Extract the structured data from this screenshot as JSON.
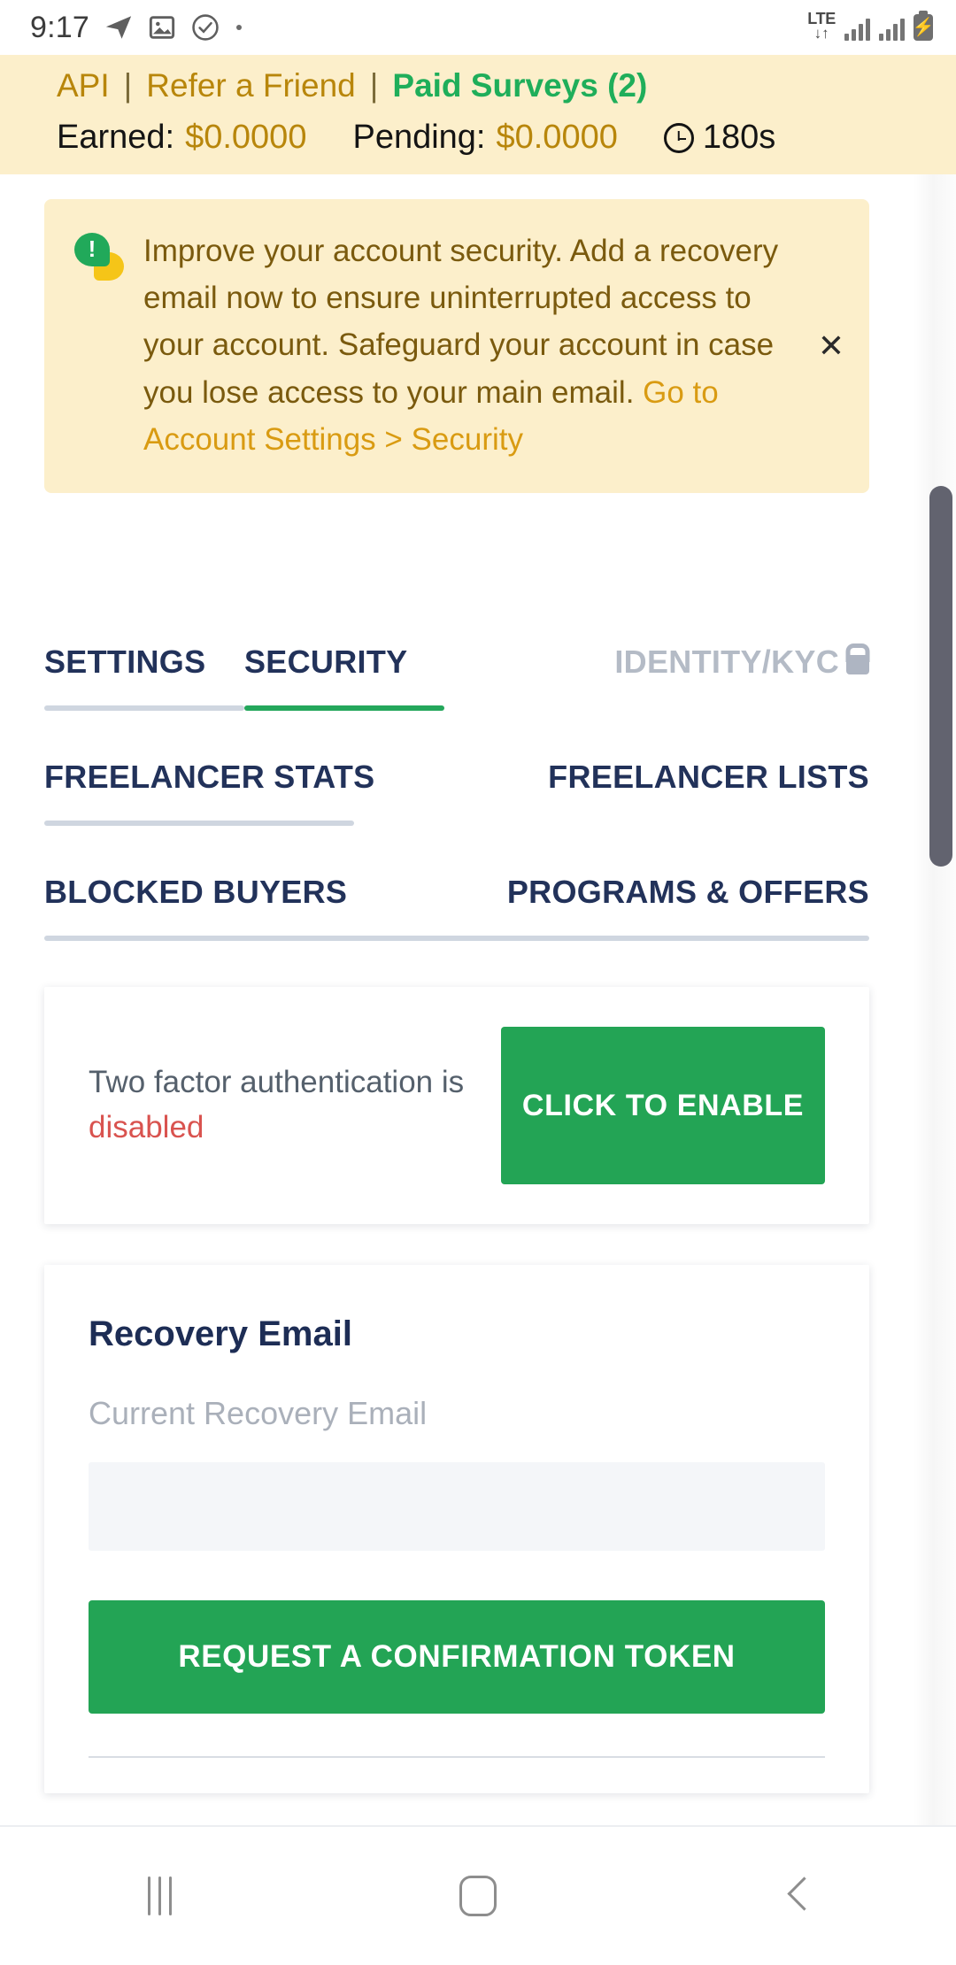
{
  "status_bar": {
    "time": "9:17",
    "icons_left": [
      "telegram-icon",
      "gallery-icon",
      "check-circle-icon",
      "dot-icon"
    ],
    "network_type": "LTE",
    "network_arrows": "↓↑",
    "icons_right": [
      "signal-bars-icon",
      "signal-bars-icon",
      "battery-charging-icon"
    ]
  },
  "top_bar": {
    "links": [
      {
        "label": "API",
        "name": "api-link"
      },
      {
        "label": "Refer a Friend",
        "name": "refer-a-friend-link"
      },
      {
        "label": "Paid Surveys (2)",
        "name": "paid-surveys-link"
      }
    ],
    "separator": "|",
    "earned_label": "Earned:",
    "earned_value": "$0.0000",
    "pending_label": "Pending:",
    "pending_value": "$0.0000",
    "timer_value": "180s",
    "colors": {
      "background": "#fcefcb",
      "link": "#b8860b",
      "accent_green": "#1fae5a"
    }
  },
  "alert": {
    "icon": "speech-bubbles-alert-icon",
    "text": "Improve your account security. Add a recovery email now to ensure uninterrupted access to your account. Safeguard your account in case you lose access to your main email. ",
    "link_text": "Go to Account Settings > Security",
    "close_label": "✕",
    "colors": {
      "background": "#fcefcb",
      "text": "#7a5a0e",
      "link": "#d99b12"
    }
  },
  "tabs": [
    {
      "label": "SETTINGS",
      "name": "tab-settings",
      "active": false,
      "locked": false
    },
    {
      "label": "SECURITY",
      "name": "tab-security",
      "active": true,
      "locked": false
    },
    {
      "label": "IDENTITY/KYC",
      "name": "tab-identity-kyc",
      "active": false,
      "locked": true
    },
    {
      "label": "FREELANCER STATS",
      "name": "tab-freelancer-stats",
      "active": false,
      "locked": false
    },
    {
      "label": "FREELANCER LISTS",
      "name": "tab-freelancer-lists",
      "active": false,
      "locked": false
    },
    {
      "label": "BLOCKED BUYERS",
      "name": "tab-blocked-buyers",
      "active": false,
      "locked": false
    },
    {
      "label": "PROGRAMS & OFFERS",
      "name": "tab-programs-offers",
      "active": false,
      "locked": false
    }
  ],
  "two_factor": {
    "description": "Two factor authentication is",
    "state": "disabled",
    "button_label": "CLICK TO ENABLE",
    "state_color": "#d9534f"
  },
  "recovery_email": {
    "title": "Recovery Email",
    "field_label": "Current Recovery Email",
    "field_value": "",
    "field_placeholder": "",
    "button_label": "REQUEST A CONFIRMATION TOKEN"
  },
  "nav_bar": {
    "buttons": [
      {
        "name": "recents-button",
        "icon": "recents-icon"
      },
      {
        "name": "home-button",
        "icon": "home-icon"
      },
      {
        "name": "back-button",
        "icon": "back-chevron-icon"
      }
    ]
  },
  "theme": {
    "green": "#23a455",
    "navy": "#22325a",
    "divider": "#cfd6e0"
  }
}
